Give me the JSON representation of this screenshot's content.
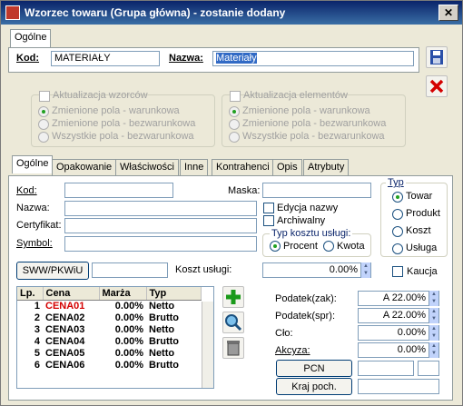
{
  "window": {
    "title": "Wzorzec towaru (Grupa główna) - zostanie dodany",
    "close": "✕"
  },
  "top_tab": "Ogólne",
  "top": {
    "kod_label": "Kod:",
    "kod_value": "MATERIAŁY",
    "nazwa_label": "Nazwa:",
    "nazwa_value": "Materiały"
  },
  "group_wzorcow": {
    "title": "Aktualizacja wzorców",
    "options": [
      "Zmienione pola - warunkowa",
      "Zmienione pola - bezwarunkowa",
      "Wszystkie pola - bezwarunkowa"
    ]
  },
  "group_elementow": {
    "title": "Aktualizacja elementów",
    "options": [
      "Zmienione pola - warunkowa",
      "Zmienione pola - bezwarunkowa",
      "Wszystkie pola - bezwarunkowa"
    ]
  },
  "tabs": [
    "Ogólne",
    "Opakowanie",
    "Właściwości",
    "Inne",
    "Kontrahenci",
    "Opis",
    "Atrybuty"
  ],
  "form": {
    "kod": "Kod:",
    "nazwa": "Nazwa:",
    "certyfikat": "Certyfikat:",
    "symbol": "Symbol:",
    "maska": "Maska:",
    "edycja_nazwy": "Edycja nazwy",
    "archiwalny": "Archiwalny",
    "typ_kosztu_title": "Typ kosztu usługi:",
    "procent": "Procent",
    "kwota": "Kwota",
    "sww_button": "SWW/PKWiU",
    "koszt_uslugi": "Koszt usługi:",
    "koszt_value": "0.00%",
    "kaucja": "Kaucja"
  },
  "typ": {
    "title": "Typ",
    "options": [
      "Towar",
      "Produkt",
      "Koszt",
      "Usługa"
    ],
    "selected": 0
  },
  "prices": {
    "headers": [
      "Lp.",
      "Cena",
      "Marża",
      "Typ"
    ],
    "rows": [
      {
        "lp": "1",
        "cena": "CENA01",
        "marza": "0.00%",
        "typ": "Netto"
      },
      {
        "lp": "2",
        "cena": "CENA02",
        "marza": "0.00%",
        "typ": "Brutto"
      },
      {
        "lp": "3",
        "cena": "CENA03",
        "marza": "0.00%",
        "typ": "Netto"
      },
      {
        "lp": "4",
        "cena": "CENA04",
        "marza": "0.00%",
        "typ": "Brutto"
      },
      {
        "lp": "5",
        "cena": "CENA05",
        "marza": "0.00%",
        "typ": "Netto"
      },
      {
        "lp": "6",
        "cena": "CENA06",
        "marza": "0.00%",
        "typ": "Brutto"
      }
    ]
  },
  "tax": {
    "podatek_zak_label": "Podatek(zak):",
    "podatek_zak_value": "A 22.00%",
    "podatek_spr_label": "Podatek(spr):",
    "podatek_spr_value": "A 22.00%",
    "clo_label": "Cło:",
    "clo_value": "0.00%",
    "akcyza_label": "Akcyza:",
    "akcyza_value": "0.00%",
    "pcn_button": "PCN",
    "kraj_button": "Kraj poch."
  },
  "colors": {
    "accent_red": "#d40000",
    "title_bg": "#0a246a"
  }
}
